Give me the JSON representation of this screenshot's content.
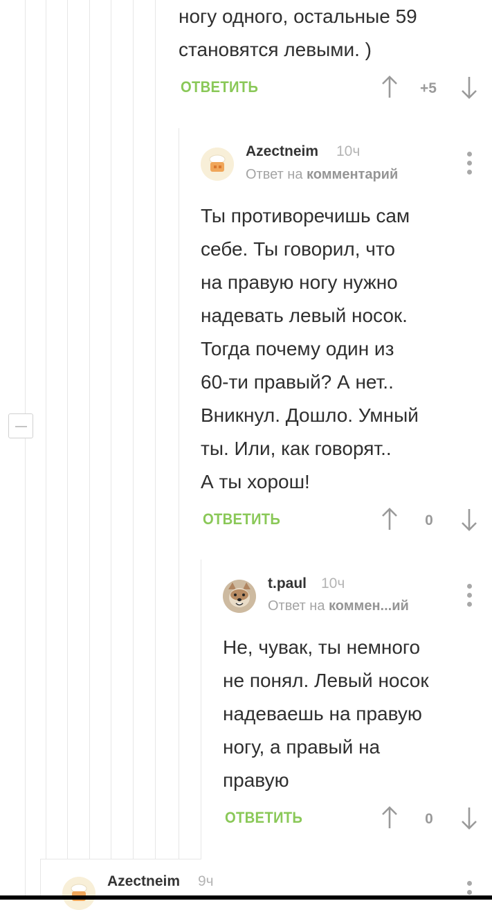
{
  "comments": [
    {
      "text": "ногу одного, остальные 59\nстановятся левыми. )",
      "reply_label": "ОТВЕТИТЬ",
      "rating": "+5"
    },
    {
      "username": "Azectneim",
      "time": "10ч",
      "reply_to_prefix": "Ответ на",
      "reply_to_link": "комментарий",
      "text": "Ты противоречишь сам\nсебе. Ты говорил, что\nна правую ногу нужно\nнадевать левый носок.\nТогда почему один из\n60-ти правый? А нет..\nВникнул. Дошло. Умный\nты. Или, как говорят..\nА ты хорош!",
      "reply_label": "ОТВЕТИТЬ",
      "rating": "0",
      "avatar_icon": "chef-hat-avatar"
    },
    {
      "username": "t.paul",
      "time": "10ч",
      "reply_to_prefix": "Ответ на",
      "reply_to_link": "коммен...ий",
      "text": "Не, чувак, ты немного\nне понял. Левый носок\nнадеваешь на правую\nногу, а правый на\nправую",
      "reply_label": "ОТВЕТИТЬ",
      "rating": "0",
      "avatar_icon": "dog-avatar"
    },
    {
      "username": "Azectneim",
      "time": "9ч",
      "avatar_icon": "chef-hat-avatar"
    }
  ],
  "colors": {
    "accent_green": "#8ac858",
    "thread_line": "#e6e6e6",
    "muted_text": "#a4a4a4"
  }
}
